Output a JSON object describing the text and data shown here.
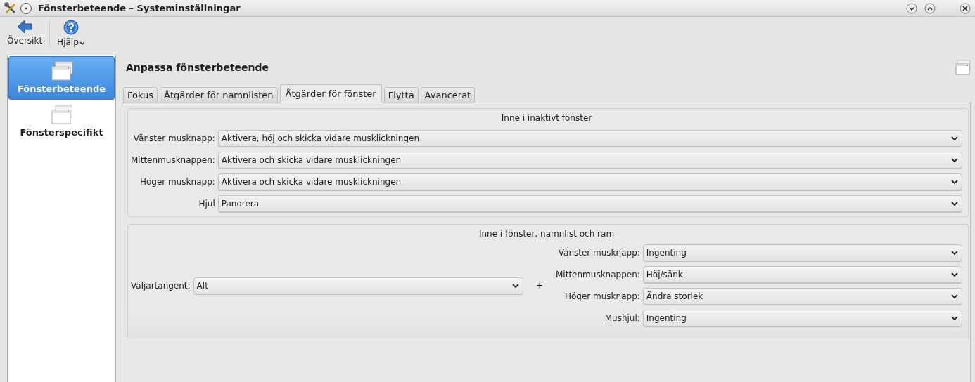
{
  "window": {
    "title": "Fönsterbeteende – Systeminställningar"
  },
  "toolbar": [
    {
      "label": "Översikt",
      "kind": "back"
    },
    {
      "label": "Hjälp",
      "kind": "help"
    }
  ],
  "sidebar": {
    "items": [
      {
        "label": "Fönsterbeteende",
        "selected": true
      },
      {
        "label": "Fönsterspecifikt",
        "selected": false
      }
    ]
  },
  "page_title": "Anpassa fönsterbeteende",
  "tabs": [
    {
      "label": "Fokus",
      "selected": false
    },
    {
      "label": "Åtgärder för namnlisten",
      "selected": false
    },
    {
      "label": "Åtgärder för fönster",
      "selected": true
    },
    {
      "label": "Flytta",
      "selected": false
    },
    {
      "label": "Avancerat",
      "selected": false
    }
  ],
  "inactive_group": {
    "title": "Inne i inaktivt fönster",
    "rows": [
      {
        "label": "Vänster musknapp:",
        "value": "Aktivera, höj och skicka vidare musklickningen"
      },
      {
        "label": "Mittenmusknappen:",
        "value": "Aktivera och skicka vidare musklickningen"
      },
      {
        "label": "Höger musknapp:",
        "value": "Aktivera och skicka vidare musklickningen"
      },
      {
        "label": "Hjul",
        "value": "Panorera"
      }
    ]
  },
  "frame_group": {
    "title": "Inne i fönster, namnlist och ram",
    "modifier": {
      "label": "Väljartangent:",
      "value": "Alt"
    },
    "plus": "+",
    "rows": [
      {
        "label": "Vänster musknapp:",
        "value": "Ingenting"
      },
      {
        "label": "Mittenmusknappen:",
        "value": "Höj/sänk"
      },
      {
        "label": "Höger musknapp:",
        "value": "Ändra storlek"
      },
      {
        "label": "Mushjul:",
        "value": "Ingenting"
      }
    ]
  }
}
